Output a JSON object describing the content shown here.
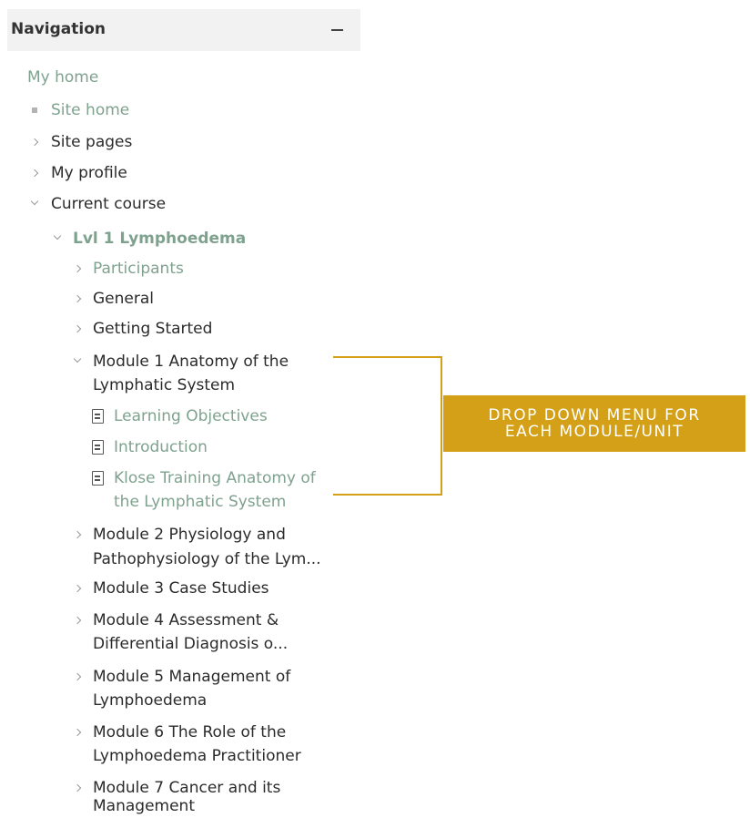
{
  "block": {
    "title": "Navigation",
    "collapse_label": "—"
  },
  "nav": {
    "my_home": "My home",
    "site_home": "Site home",
    "site_pages": "Site pages",
    "my_profile": "My profile",
    "current_course": "Current course",
    "course_name": "Lvl 1 Lymphoedema",
    "participants": "Participants",
    "general": "General",
    "getting_started": "Getting Started",
    "module1_line1": "Module 1 Anatomy of the",
    "module1_line2": "Lymphatic System",
    "module1_items": [
      "Learning Objectives",
      "Introduction",
      "Klose Training Anatomy of",
      "the Lymphatic System"
    ],
    "modules": [
      {
        "line1": "Module 2 Physiology and",
        "line2": "Pathophysiology of the Lym..."
      },
      {
        "line1": "Module 3 Case Studies",
        "line2": ""
      },
      {
        "line1": "Module 4 Assessment &",
        "line2": "Differential Diagnosis o..."
      },
      {
        "line1": "Module 5 Management of",
        "line2": "Lymphoedema"
      },
      {
        "line1": "Module 6 The Role of the",
        "line2": "Lymphoedema Practitioner"
      },
      {
        "line1": "Module 7 Cancer and its",
        "line2": "Management"
      }
    ]
  },
  "callout": {
    "line1": "DROP DOWN MENU FOR",
    "line2": "EACH MODULE/UNIT"
  },
  "colors": {
    "link": "#7fa28f",
    "callout": "#d4a017",
    "header_bg": "#f2f2f2"
  }
}
